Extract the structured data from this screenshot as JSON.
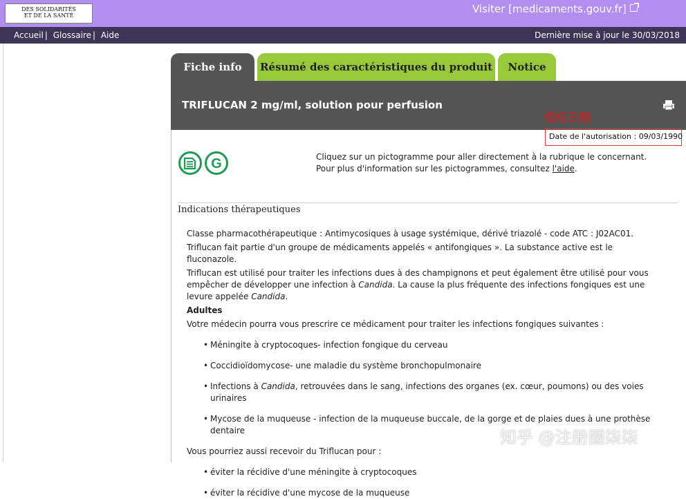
{
  "header": {
    "logo_line1": "DES SOLIDARITÉS",
    "logo_line2": "ET DE LA SANTÉ",
    "visiter": "Visiter [medicaments.gouv.fr]"
  },
  "nav": {
    "accueil": "Accueil",
    "glossaire": "Glossaire",
    "aide": "Aide",
    "sep": "|",
    "last_update": "Dernière mise à jour le 30/03/2018"
  },
  "tabs": [
    {
      "label": "Fiche info"
    },
    {
      "label": "Résumé des caractéristiques du produit"
    },
    {
      "label": "Notice"
    }
  ],
  "product": {
    "title": "TRIFLUCAN 2 mg/ml, solution pour perfusion"
  },
  "annotation": "授权日期",
  "auth_date": "Date de l'autorisation : 09/03/1990",
  "pictogram": {
    "line1": "Cliquez sur un pictogramme pour aller directement à la rubrique le concernant.",
    "line2_pre": "Pour plus d'information sur les pictogrammes, consultez ",
    "line2_link": "l'aide",
    "line2_post": "."
  },
  "section": {
    "title": "Indications thérapeutiques",
    "para1": "Classe pharmacothérapeutique : Antimycosiques à usage systémique, dérivé triazolé - code ATC : J02AC01.",
    "para2": "Triflucan fait partie d'un groupe de médicaments appelés « antifongiques ». La substance active est le fluconazole.",
    "para3a": "Triflucan est utilisé pour traiter les infections dues à des champignons et peut également être utilisé pour vous empêcher de développer une infection à ",
    "candida": "Candida",
    "para3b": ". La cause la plus fréquente des infections fongiques est une levure appelée ",
    "para3c": ".",
    "adultes": "Adultes",
    "para4": "Votre médecin pourra vous prescrire ce médicament pour traiter les infections fongiques suivantes :",
    "item1": "Méningite à cryptocoques- infection fongique du cerveau",
    "item2": "Coccidioïdomycose- une maladie du système bronchopulmonaire",
    "item3a": "Infections à ",
    "item3b": ", retrouvées dans le sang, infections des organes (ex. cœur, poumons) ou des voies urinaires",
    "item4": "Mycose de la muqueuse - infection de la muqueuse buccale, de la gorge et de plaies dues à une prothèse dentaire",
    "para5": "Vous pourriez aussi recevoir du Triflucan pour :",
    "item5": "éviter la récidive d'une méningite à cryptocoques",
    "item6": "éviter la récidive d'une mycose de la muqueuse"
  },
  "watermark": "知乎 @注册圈柒柒",
  "colors": {
    "topband": "#b18ef0",
    "navbar": "#3d3556",
    "tab_active": "#555555",
    "tab_inactive": "#97c93b",
    "pictogram": "#1e9a53",
    "annotation": "#e21b1b"
  }
}
